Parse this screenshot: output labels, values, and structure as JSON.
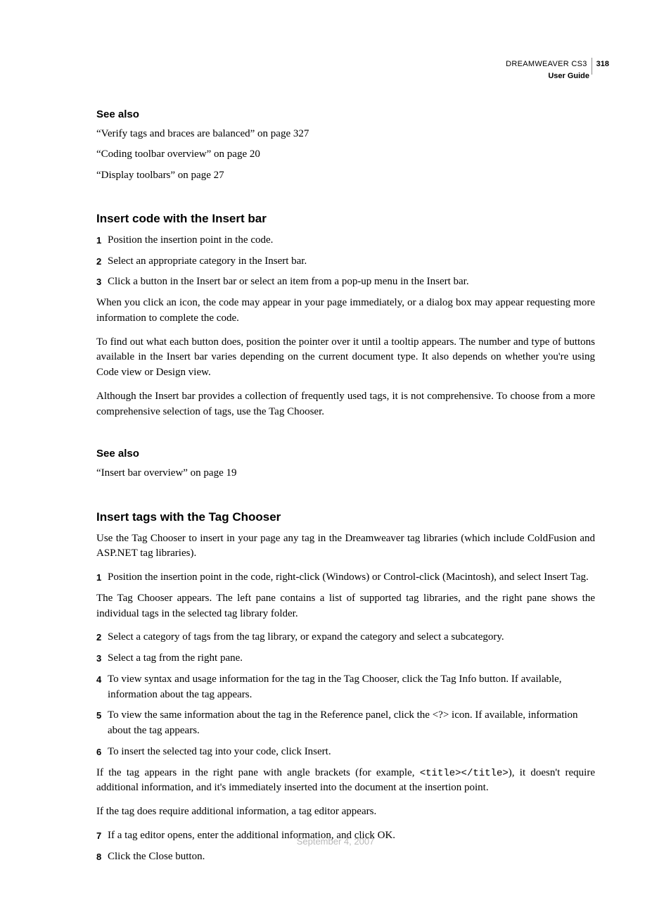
{
  "header": {
    "product": "DREAMWEAVER CS3",
    "page_number": "318",
    "subtitle": "User Guide"
  },
  "see_also_1": {
    "title": "See also",
    "links": [
      "“Verify tags and braces are balanced” on page 327",
      "“Coding toolbar overview” on page 20",
      "“Display toolbars” on page 27"
    ]
  },
  "section_insert_bar": {
    "heading": "Insert code with the Insert bar",
    "steps": [
      "Position the insertion point in the code.",
      "Select an appropriate category in the Insert bar.",
      "Click a button in the Insert bar or select an item from a pop-up menu in the Insert bar."
    ],
    "paras": [
      "When you click an icon, the code may appear in your page immediately, or a dialog box may appear requesting more information to complete the code.",
      "To find out what each button does, position the pointer over it until a tooltip appears. The number and type of buttons available in the Insert bar varies depending on the current document type. It also depends on whether you're using Code view or Design view.",
      "Although the Insert bar provides a collection of frequently used tags, it is not comprehensive. To choose from a more comprehensive selection of tags, use the Tag Chooser."
    ]
  },
  "see_also_2": {
    "title": "See also",
    "links": [
      "“Insert bar overview” on page 19"
    ]
  },
  "section_tag_chooser": {
    "heading": "Insert tags with the Tag Chooser",
    "intro": "Use the Tag Chooser to insert in your page any tag in the Dreamweaver tag libraries (which include ColdFusion and ASP.NET tag libraries).",
    "step1": "Position the insertion point in the code, right-click (Windows) or Control-click (Macintosh), and select Insert Tag.",
    "after_step1": "The Tag Chooser appears. The left pane contains a list of supported tag libraries, and the right pane shows the individual tags in the selected tag library folder.",
    "step2": "Select a category of tags from the tag library, or expand the category and select a subcategory.",
    "step3": "Select a tag from the right pane.",
    "step4": "To view syntax and usage information for the tag in the Tag Chooser, click the Tag Info button. If available, information about the tag appears.",
    "step5": "To view the same information about the tag in the Reference panel, click the <?> icon. If available, information about the tag appears.",
    "step6": "To insert the selected tag into your code, click Insert.",
    "after_step6_pre": "If the tag appears in the right pane with angle brackets (for example, ",
    "after_step6_code": "<title></title>",
    "after_step6_post": "), it doesn't require additional information, and it's immediately inserted into the document at the insertion point.",
    "after_step6b": "If the tag does require additional information, a tag editor appears.",
    "step7": "If a tag editor opens, enter the additional information, and click OK.",
    "step8": "Click the Close button."
  },
  "footer": {
    "date": "September 4, 2007"
  }
}
